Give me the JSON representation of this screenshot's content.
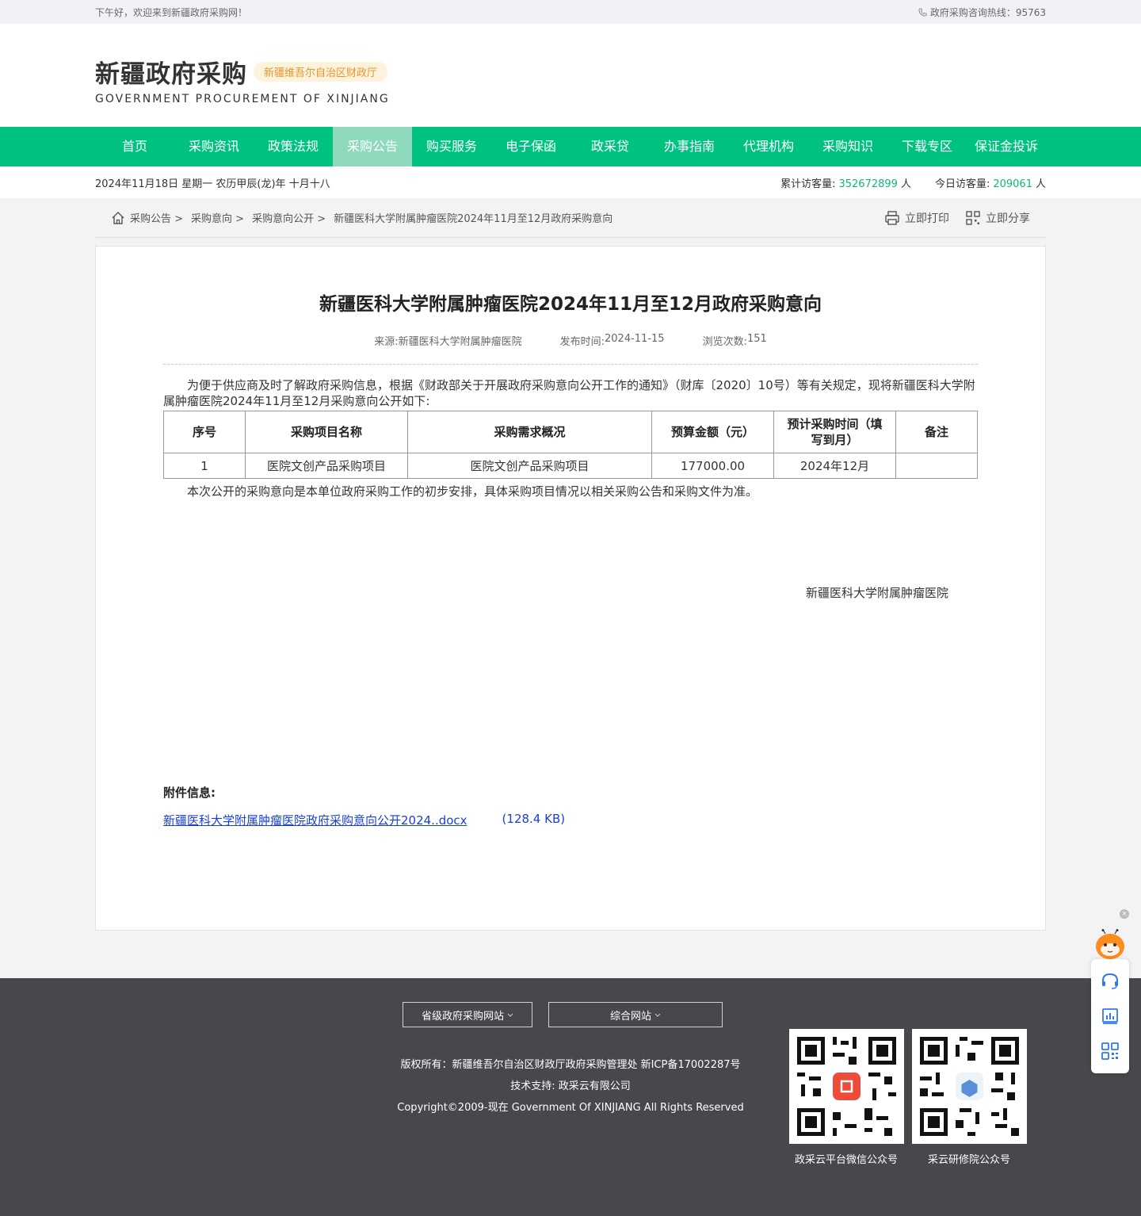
{
  "topbar": {
    "greeting": "下午好，欢迎来到新疆政府采购网！",
    "hotline": "政府采购咨询热线：95763"
  },
  "header": {
    "logo_cn": "新疆政府采购",
    "logo_badge": "新疆维吾尔自治区财政厅",
    "logo_en": "GOVERNMENT PROCUREMENT OF XINJIANG"
  },
  "nav": {
    "items": [
      "首页",
      "采购资讯",
      "政策法规",
      "采购公告",
      "购买服务",
      "电子保函",
      "政采贷",
      "办事指南",
      "代理机构",
      "采购知识",
      "下载专区",
      "保证金投诉"
    ],
    "active": "采购公告"
  },
  "datebar": {
    "date": "2024年11月18日 星期一 农历甲辰(龙)年 十月十八",
    "total_label": "累计访客量:",
    "total_value": "352672899",
    "today_label": "今日访客量:",
    "today_value": "209061",
    "unit": "人"
  },
  "breadcrumb": {
    "items": [
      "采购公告 >",
      "采购意向 >",
      "采购意向公开 >",
      "新疆医科大学附属肿瘤医院2024年11月至12月政府采购意向"
    ],
    "print": "立即打印",
    "share": "立即分享"
  },
  "article": {
    "title": "新疆医科大学附属肿瘤医院2024年11月至12月政府采购意向",
    "source_label": "来源:",
    "source": "新疆医科大学附属肿瘤医院",
    "date_label": "发布时间:",
    "date": "2024-11-15",
    "views_label": "浏览次数:",
    "views": "151",
    "intro": "为便于供应商及时了解政府采购信息，根据《财政部关于开展政府采购意向公开工作的通知》（财库〔2020〕10号）等有关规定，现将新疆医科大学附属肿瘤医院2024年11月至12月采购意向公开如下:",
    "table": {
      "headers": [
        "序号",
        "采购项目名称",
        "采购需求概况",
        "预算金额（元）",
        "预计采购时间（填写到月）",
        "备注"
      ],
      "rows": [
        [
          "1",
          "医院文创产品采购项目",
          "医院文创产品采购项目",
          "177000.00",
          "2024年12月",
          ""
        ]
      ]
    },
    "closing": "本次公开的采购意向是本单位政府采购工作的初步安排，具体采购项目情况以相关采购公告和采购文件为准。",
    "signature": "新疆医科大学附属肿瘤医院",
    "attach_title": "附件信息:",
    "attach_name": "新疆医科大学附属肿瘤医院政府采购意向公开2024..docx",
    "attach_size": "(128.4 KB)"
  },
  "footer": {
    "select1": "省级政府采购网站",
    "select2": "综合网站",
    "copyright": "版权所有：新疆维吾尔自治区财政厅政府采购管理处 新ICP备17002287号",
    "tech": "技术支持: 政采云有限公司",
    "copyright_en": "Copyright©2009-现在 Government Of XINJIANG All Rights Reserved",
    "qr1_label": "政采云平台微信公众号",
    "qr2_label": "采云研修院公众号"
  },
  "colors": {
    "brand": "#00c280",
    "nav_active": "#8fd9bd",
    "footer": "#46484c",
    "link": "#1a3fd6"
  }
}
